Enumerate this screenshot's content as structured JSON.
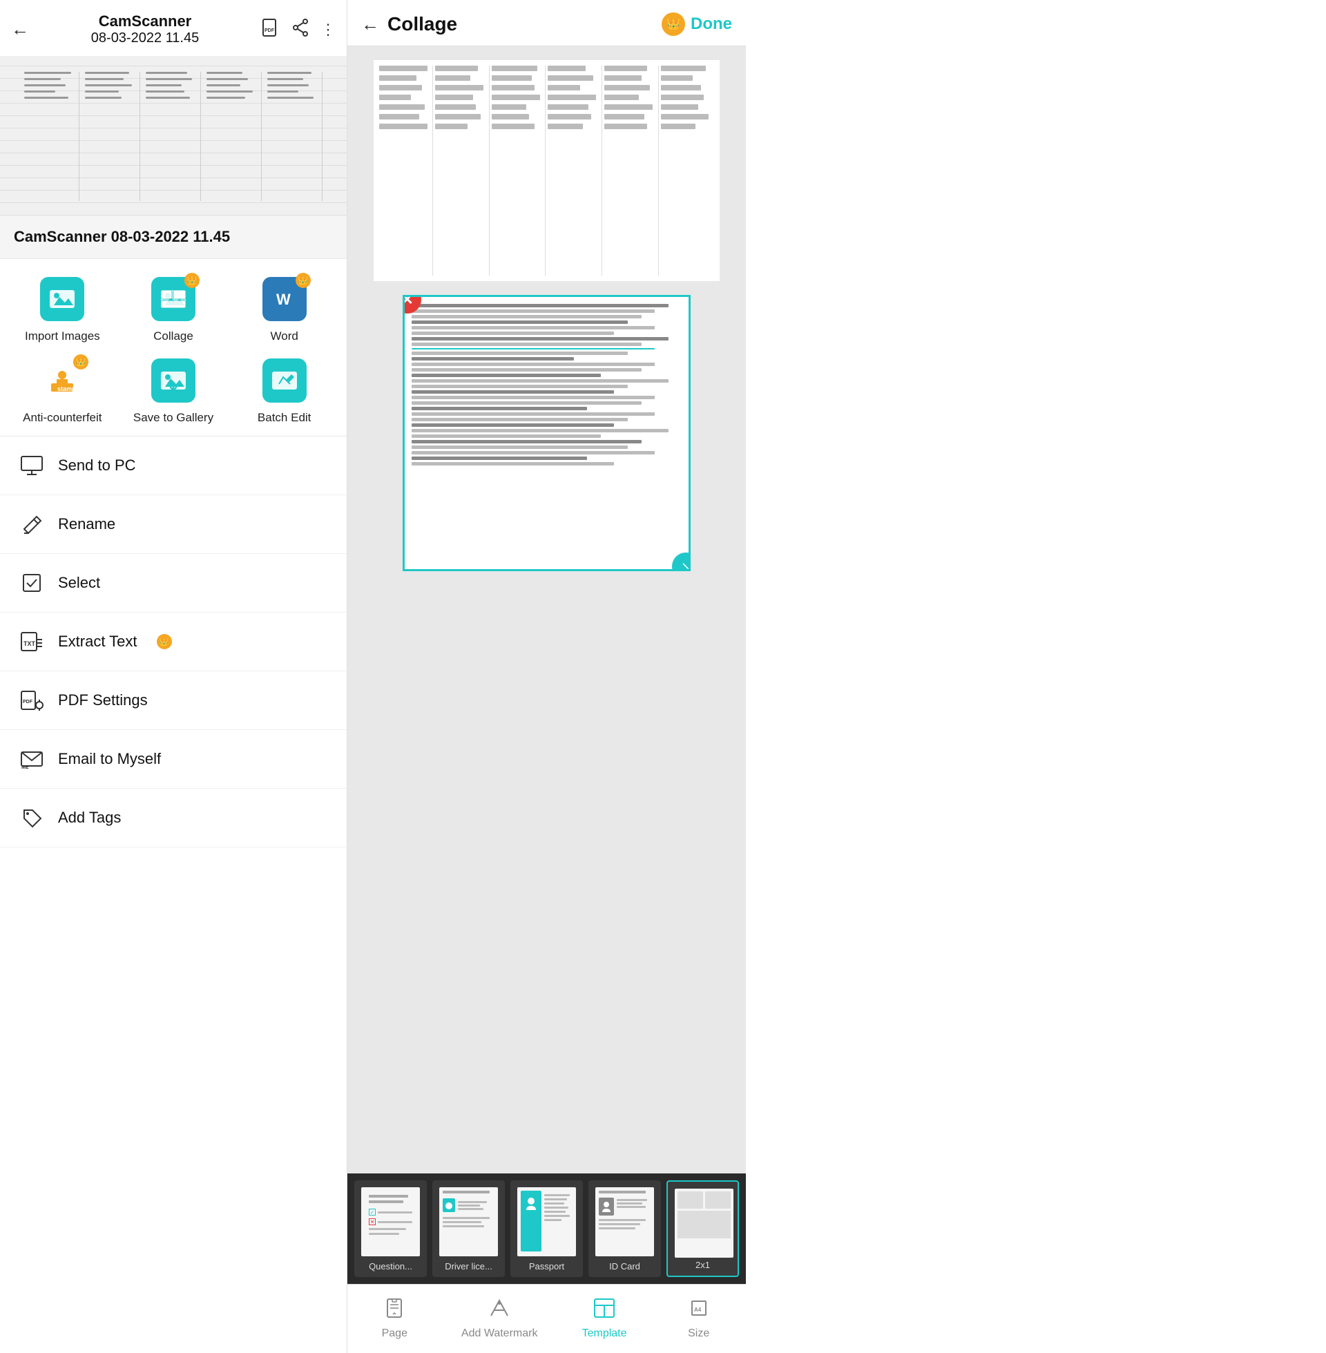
{
  "left": {
    "header": {
      "back_label": "←",
      "app_name": "CamScanner",
      "doc_date": "08-03-2022 11.45",
      "icons": [
        "pdf-icon",
        "share-icon",
        "more-icon"
      ]
    },
    "doc_title": "CamScanner 08-03-2022 11.45",
    "actions": [
      {
        "id": "import-images",
        "label": "Import Images",
        "icon": "image-icon",
        "bg": "teal",
        "crown": false
      },
      {
        "id": "collage",
        "label": "Collage",
        "icon": "collage-icon",
        "bg": "teal",
        "crown": true
      },
      {
        "id": "word",
        "label": "Word",
        "icon": "word-icon",
        "bg": "blue",
        "crown": true
      },
      {
        "id": "anti-counterfeit",
        "label": "Anti-counterfeit",
        "icon": "shield-icon",
        "bg": "orange",
        "crown": true
      },
      {
        "id": "save-to-gallery",
        "label": "Save to Gallery",
        "icon": "gallery-icon",
        "bg": "teal",
        "crown": false
      },
      {
        "id": "batch-edit",
        "label": "Batch Edit",
        "icon": "edit-icon",
        "bg": "teal2",
        "crown": false
      }
    ],
    "menu": [
      {
        "id": "send-to-pc",
        "label": "Send to PC",
        "icon": "monitor-icon",
        "crown": false
      },
      {
        "id": "rename",
        "label": "Rename",
        "icon": "pencil-icon",
        "crown": false
      },
      {
        "id": "select",
        "label": "Select",
        "icon": "checkbox-icon",
        "crown": false
      },
      {
        "id": "extract-text",
        "label": "Extract Text",
        "icon": "txt-icon",
        "crown": true
      },
      {
        "id": "pdf-settings",
        "label": "PDF Settings",
        "icon": "pdf-settings-icon",
        "crown": false
      },
      {
        "id": "email-to-myself",
        "label": "Email to Myself",
        "icon": "email-icon",
        "crown": false
      },
      {
        "id": "add-tags",
        "label": "Add Tags",
        "icon": "tag-icon",
        "crown": false
      }
    ]
  },
  "right": {
    "header": {
      "back_label": "←",
      "title": "Collage",
      "done_label": "Done"
    },
    "templates": [
      {
        "id": "questionnaire",
        "label": "Question...",
        "selected": false
      },
      {
        "id": "driver-license",
        "label": "Driver lice...",
        "selected": false
      },
      {
        "id": "passport",
        "label": "Passport",
        "selected": false
      },
      {
        "id": "id-card",
        "label": "ID Card",
        "selected": false
      },
      {
        "id": "2x1",
        "label": "2x1",
        "selected": true
      }
    ],
    "toolbar": [
      {
        "id": "page",
        "label": "Page",
        "icon": "page-icon",
        "active": false
      },
      {
        "id": "add-watermark",
        "label": "Add Watermark",
        "icon": "watermark-icon",
        "active": false
      },
      {
        "id": "template",
        "label": "Template",
        "icon": "template-icon",
        "active": true
      },
      {
        "id": "size",
        "label": "Size",
        "icon": "size-icon",
        "active": false
      }
    ]
  }
}
